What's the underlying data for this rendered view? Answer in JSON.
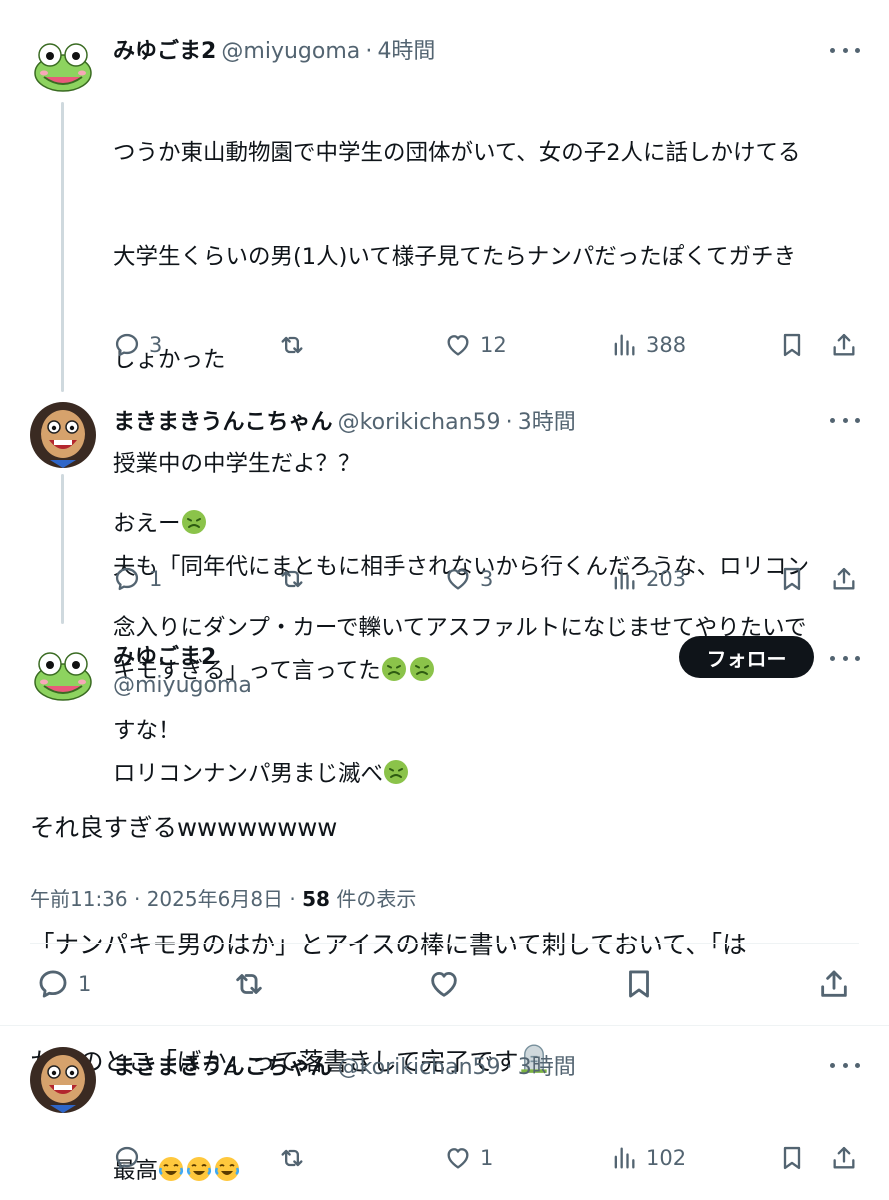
{
  "tweets": [
    {
      "name": "みゆごま2",
      "handle": "@miyugoma",
      "time": "4時間",
      "lines": [
        "つうか東山動物園で中学生の団体がいて、女の子2人に話しかけてる",
        "大学生くらいの男(1人)いて様子見てたらナンパだったぽくてガチき",
        "しょかった",
        "授業中の中学生だよ？？",
        "夫も「同年代にまともに相手されないから行くんだろうな、ロリコン",
        "キモすぎる」って言ってた",
        "ロリコンナンパ男まじ滅べ"
      ],
      "replies": "3",
      "retweets": "",
      "likes": "12",
      "views": "388"
    },
    {
      "name": "まきまきうんこちゃん",
      "handle": "@korikichan59",
      "time": "3時間",
      "lines": [
        "おえー",
        "念入りにダンプ・カーで轢いてアスファルトになじませてやりたいで",
        "すな！"
      ],
      "replies": "1",
      "retweets": "",
      "likes": "3",
      "views": "203"
    }
  ],
  "main_tweet": {
    "name": "みゆごま2",
    "handle": "@miyugoma",
    "follow_label": "フォロー",
    "lines": [
      "それ良すぎるwwwwwwww",
      "「ナンパキモ男のはか」とアイスの棒に書いて刺しておいて、「は",
      "か」のとこ「ばか」って落書きして完了です"
    ],
    "timestamp": "午前11:36 · 2025年6月8日 · ",
    "view_count": "58",
    "view_label": " 件の表示",
    "replies": "1"
  },
  "reply": {
    "name": "まきまきうんこちゃん",
    "handle": "@korikichan59",
    "time": "3時間",
    "text": "最高",
    "replies": "",
    "retweets": "",
    "likes": "1",
    "views": "102"
  },
  "separator": "·",
  "emoji_names": [
    "nauseated-face-emoji",
    "tears-of-joy-emoji",
    "headstone-emoji"
  ],
  "colors": {
    "text": "#0f1419",
    "secondary": "#536471",
    "thread_line": "#cfd9de",
    "follow_bg": "#0f1419",
    "frog_green": "#8dd35f"
  }
}
